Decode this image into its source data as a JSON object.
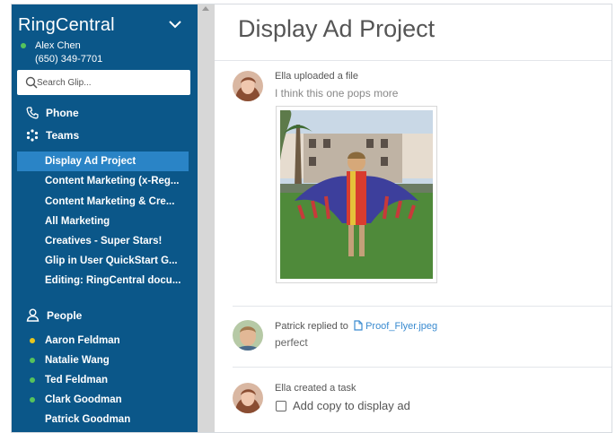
{
  "app": {
    "brand": "RingCentral"
  },
  "user": {
    "name": "Alex Chen",
    "phone": "(650) 349-7701",
    "status_color": "#56c35c"
  },
  "search": {
    "placeholder": "Search Glip..."
  },
  "sidebar": {
    "phone_label": "Phone",
    "teams_label": "Teams",
    "teams": [
      {
        "label": "Display Ad Project",
        "active": true
      },
      {
        "label": "Content Marketing (x-Reg..."
      },
      {
        "label": "Content Marketing & Cre..."
      },
      {
        "label": "All Marketing"
      },
      {
        "label": "Creatives - Super Stars!"
      },
      {
        "label": "Glip in User QuickStart G..."
      },
      {
        "label": "Editing: RingCentral docu..."
      }
    ],
    "people_label": "People",
    "people": [
      {
        "label": "Aaron Feldman",
        "status": "away",
        "color": "#e8c61e"
      },
      {
        "label": "Natalie Wang",
        "status": "online",
        "color": "#56c35c"
      },
      {
        "label": "Ted Feldman",
        "status": "online",
        "color": "#56c35c"
      },
      {
        "label": "Clark Goodman",
        "status": "online",
        "color": "#56c35c"
      },
      {
        "label": "Patrick Goodman",
        "status": "none"
      }
    ]
  },
  "conversation": {
    "title": "Display Ad Project",
    "posts": [
      {
        "meta": "Ella uploaded a file",
        "text": "I think this one pops more"
      },
      {
        "meta_prefix": "Patrick replied to",
        "file_name": "Proof_Flyer.jpeg",
        "text": "perfect"
      },
      {
        "meta": "Ella created a task",
        "task": "Add copy to display ad"
      }
    ]
  },
  "colors": {
    "sidebar": "#0b5789",
    "active_item": "#2a84c6",
    "link": "#3a8bd0"
  }
}
